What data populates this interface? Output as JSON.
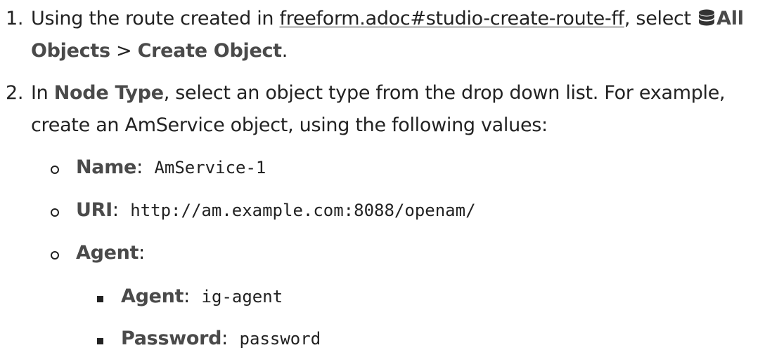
{
  "steps": [
    {
      "number": "1.",
      "text_before": "Using the route created in ",
      "link": "freeform.adoc#studio-create-route-ff",
      "text_mid": ", select ",
      "icon": "database-icon",
      "bold_all": "All",
      "bold_objects": "Objects",
      "sep": " > ",
      "bold_create": "Create Object",
      "end": "."
    },
    {
      "number": "2.",
      "text_in": "In ",
      "bold_node_type": "Node Type",
      "text_after": ", select an object type from the drop down list. For example,",
      "line2": "create an AmService object, using the following values:"
    }
  ],
  "values": [
    {
      "label": "Name",
      "value": "AmService-1"
    },
    {
      "label": "URI",
      "value": "http://am.example.com:8088/openam/"
    },
    {
      "label": "Agent",
      "value": ""
    }
  ],
  "agent_values": [
    {
      "label": "Agent",
      "value": "ig-agent"
    },
    {
      "label": "Password",
      "value": "password"
    }
  ],
  "colon": ":"
}
